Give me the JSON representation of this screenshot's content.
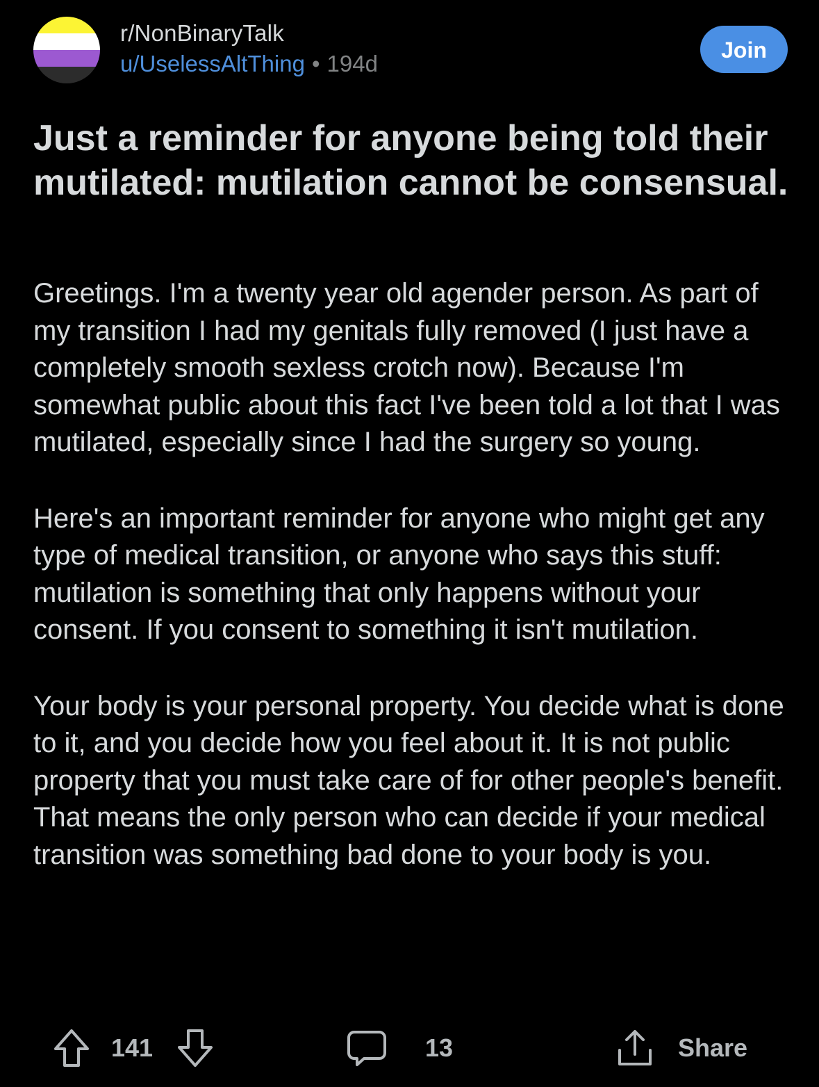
{
  "header": {
    "subreddit": "r/NonBinaryTalk",
    "username": "u/UselessAltThing",
    "separator": "•",
    "age": "194d",
    "join_label": "Join",
    "avatar_colors": [
      "#fcf434",
      "#ffffff",
      "#9c59d1",
      "#2c2c2c"
    ]
  },
  "post": {
    "title": "Just a reminder for anyone being told their mutilated: mutilation cannot be consensual.",
    "paragraphs": [
      "Greetings. I'm a twenty year old agender person. As part of my transition I had my genitals fully removed (I just have a completely smooth sexless crotch now). Because I'm somewhat public about this fact I've been told a lot that I was mutilated, especially since I had the surgery so young.",
      "Here's an important reminder for anyone who might get any type of medical transition, or anyone who says this stuff: mutilation is something that only happens without your consent. If you consent to something it isn't mutilation.",
      "Your body is your personal property. You decide what is done to it, and you decide how you feel about it. It is not public property that you must take care of for other people's benefit. That means the only person who can decide if your medical transition was something bad done to your body is you."
    ]
  },
  "actions": {
    "vote_count": "141",
    "comment_count": "13",
    "share_label": "Share",
    "icons": {
      "upvote": "upvote-arrow-icon",
      "downvote": "downvote-arrow-icon",
      "comment": "comment-bubble-icon",
      "share": "share-upload-icon"
    }
  },
  "colors": {
    "background": "#000000",
    "text": "#d7dadc",
    "muted": "#818384",
    "link": "#4f8fdb",
    "join_button": "#4a8fe4"
  }
}
